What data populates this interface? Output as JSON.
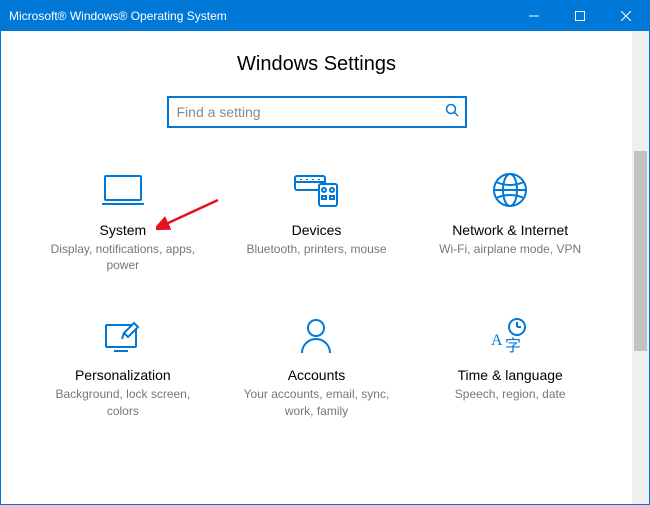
{
  "window": {
    "title": "Microsoft® Windows® Operating System"
  },
  "page": {
    "title": "Windows Settings"
  },
  "search": {
    "placeholder": "Find a setting"
  },
  "tiles": [
    {
      "label": "System",
      "desc": "Display, notifications, apps, power"
    },
    {
      "label": "Devices",
      "desc": "Bluetooth, printers, mouse"
    },
    {
      "label": "Network & Internet",
      "desc": "Wi-Fi, airplane mode, VPN"
    },
    {
      "label": "Personalization",
      "desc": "Background, lock screen, colors"
    },
    {
      "label": "Accounts",
      "desc": "Your accounts, email, sync, work, family"
    },
    {
      "label": "Time & language",
      "desc": "Speech, region, date"
    }
  ],
  "colors": {
    "accent": "#0078d7",
    "arrow": "#e81123"
  }
}
